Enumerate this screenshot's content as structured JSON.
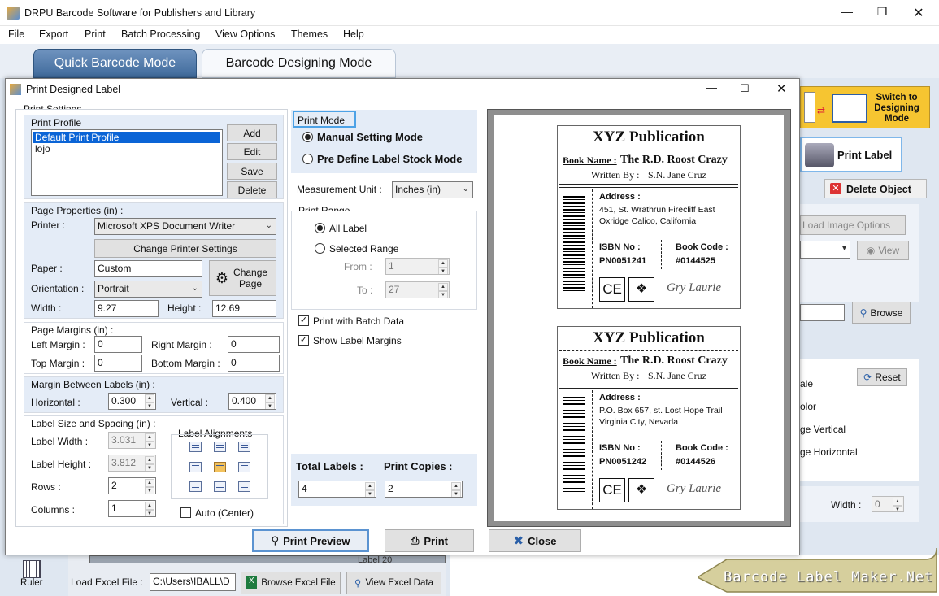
{
  "window": {
    "title": "DRPU Barcode Software for Publishers and Library"
  },
  "menu": [
    "File",
    "Export",
    "Print",
    "Batch Processing",
    "View Options",
    "Themes",
    "Help"
  ],
  "modes": {
    "quick": "Quick Barcode Mode",
    "designing": "Barcode Designing Mode"
  },
  "switch": {
    "label": "Switch to Designing Mode"
  },
  "right": {
    "print_label": "Print Label",
    "delete_object": "Delete Object",
    "load_image_options": "Load Image Options",
    "view": "View",
    "browse": "Browse",
    "reset": "Reset",
    "opt1": "ale",
    "opt2": "olor",
    "opt3": "ge Vertical",
    "opt4": "ge Horizontal",
    "width_label": "Width :",
    "width_value": "0"
  },
  "bottom": {
    "ruler": "Ruler",
    "load_excel": "Load Excel File :",
    "excel_path": "C:\\Users\\IBALL\\D",
    "browse_excel": "Browse Excel File",
    "view_excel": "View Excel Data",
    "label_fragment": "Label 20"
  },
  "brand": "Barcode Label Maker.Net",
  "dialog": {
    "title": "Print Designed Label",
    "print_settings": "Print Settings",
    "print_profile": "Print Profile",
    "profiles": [
      "Default Print Profile",
      "lojo"
    ],
    "btn_add": "Add",
    "btn_edit": "Edit",
    "btn_save": "Save",
    "btn_delete": "Delete",
    "page_properties": "Page Properties (in) :",
    "printer_label": "Printer :",
    "printer_value": "Microsoft XPS Document Writer",
    "change_printer": "Change Printer Settings",
    "paper_label": "Paper :",
    "paper_value": "Custom",
    "change_page": "Change Page",
    "orientation_label": "Orientation :",
    "orientation_value": "Portrait",
    "width_label": "Width :",
    "width_value": "9.27",
    "height_label": "Height :",
    "height_value": "12.69",
    "page_margins": "Page Margins (in) :",
    "left_margin": "Left Margin :",
    "left_margin_value": "0",
    "right_margin": "Right Margin :",
    "right_margin_value": "0",
    "top_margin": "Top Margin :",
    "top_margin_value": "0",
    "bottom_margin": "Bottom Margin :",
    "bottom_margin_value": "0",
    "margin_between": "Margin Between Labels (in) :",
    "horizontal_label": "Horizontal :",
    "horizontal_value": "0.300",
    "vertical_label": "Vertical :",
    "vertical_value": "0.400",
    "label_size": "Label Size and Spacing (in) :",
    "label_width": "Label Width :",
    "label_width_value": "3.031",
    "label_height": "Label Height :",
    "label_height_value": "3.812",
    "rows_label": "Rows :",
    "rows_value": "2",
    "columns_label": "Columns :",
    "columns_value": "1",
    "label_alignments": "Label Alignments",
    "auto_center": "Auto (Center)",
    "print_mode": "Print Mode",
    "manual_mode": "Manual Setting Mode",
    "predefine_mode": "Pre Define Label Stock Mode",
    "measurement_label": "Measurement Unit :",
    "measurement_value": "Inches (in)",
    "print_range": "Print Range",
    "all_label": "All Label",
    "selected_range": "Selected Range",
    "from_label": "From :",
    "from_value": "1",
    "to_label": "To :",
    "to_value": "27",
    "print_batch": "Print with Batch Data",
    "show_margins": "Show Label Margins",
    "total_labels": "Total Labels :",
    "total_labels_value": "4",
    "print_copies": "Print Copies :",
    "print_copies_value": "2",
    "print_preview": "Print Preview",
    "print": "Print",
    "close": "Close"
  },
  "labels": [
    {
      "title": "XYZ Publication",
      "book_name_label": "Book Name :",
      "book_name": "The R.D. Roost Crazy",
      "written_by_label": "Written By :",
      "written_by": "S.N. Jane Cruz",
      "address_label": "Address :",
      "address_line1": "451, St. Wrathrun Firecliff East",
      "address_line2": "Oxridge Calico, California",
      "isbn_label": "ISBN No :",
      "isbn": "PN0051241",
      "code_label": "Book Code :",
      "code": "#0144525",
      "signature": "Gry Laurie"
    },
    {
      "title": "XYZ Publication",
      "book_name_label": "Book Name :",
      "book_name": "The R.D. Roost Crazy",
      "written_by_label": "Written By :",
      "written_by": "S.N. Jane Cruz",
      "address_label": "Address :",
      "address_line1": "P.O. Box 657, st. Lost Hope Trail",
      "address_line2": "Virginia City, Nevada",
      "isbn_label": "ISBN No :",
      "isbn": "PN0051242",
      "code_label": "Book Code :",
      "code": "#0144526",
      "signature": "Gry Laurie"
    }
  ],
  "colors": {
    "accent_tab": "#3f6a9b",
    "switch_bg": "#f6c531",
    "brand_bg": "#d6cf9d"
  }
}
